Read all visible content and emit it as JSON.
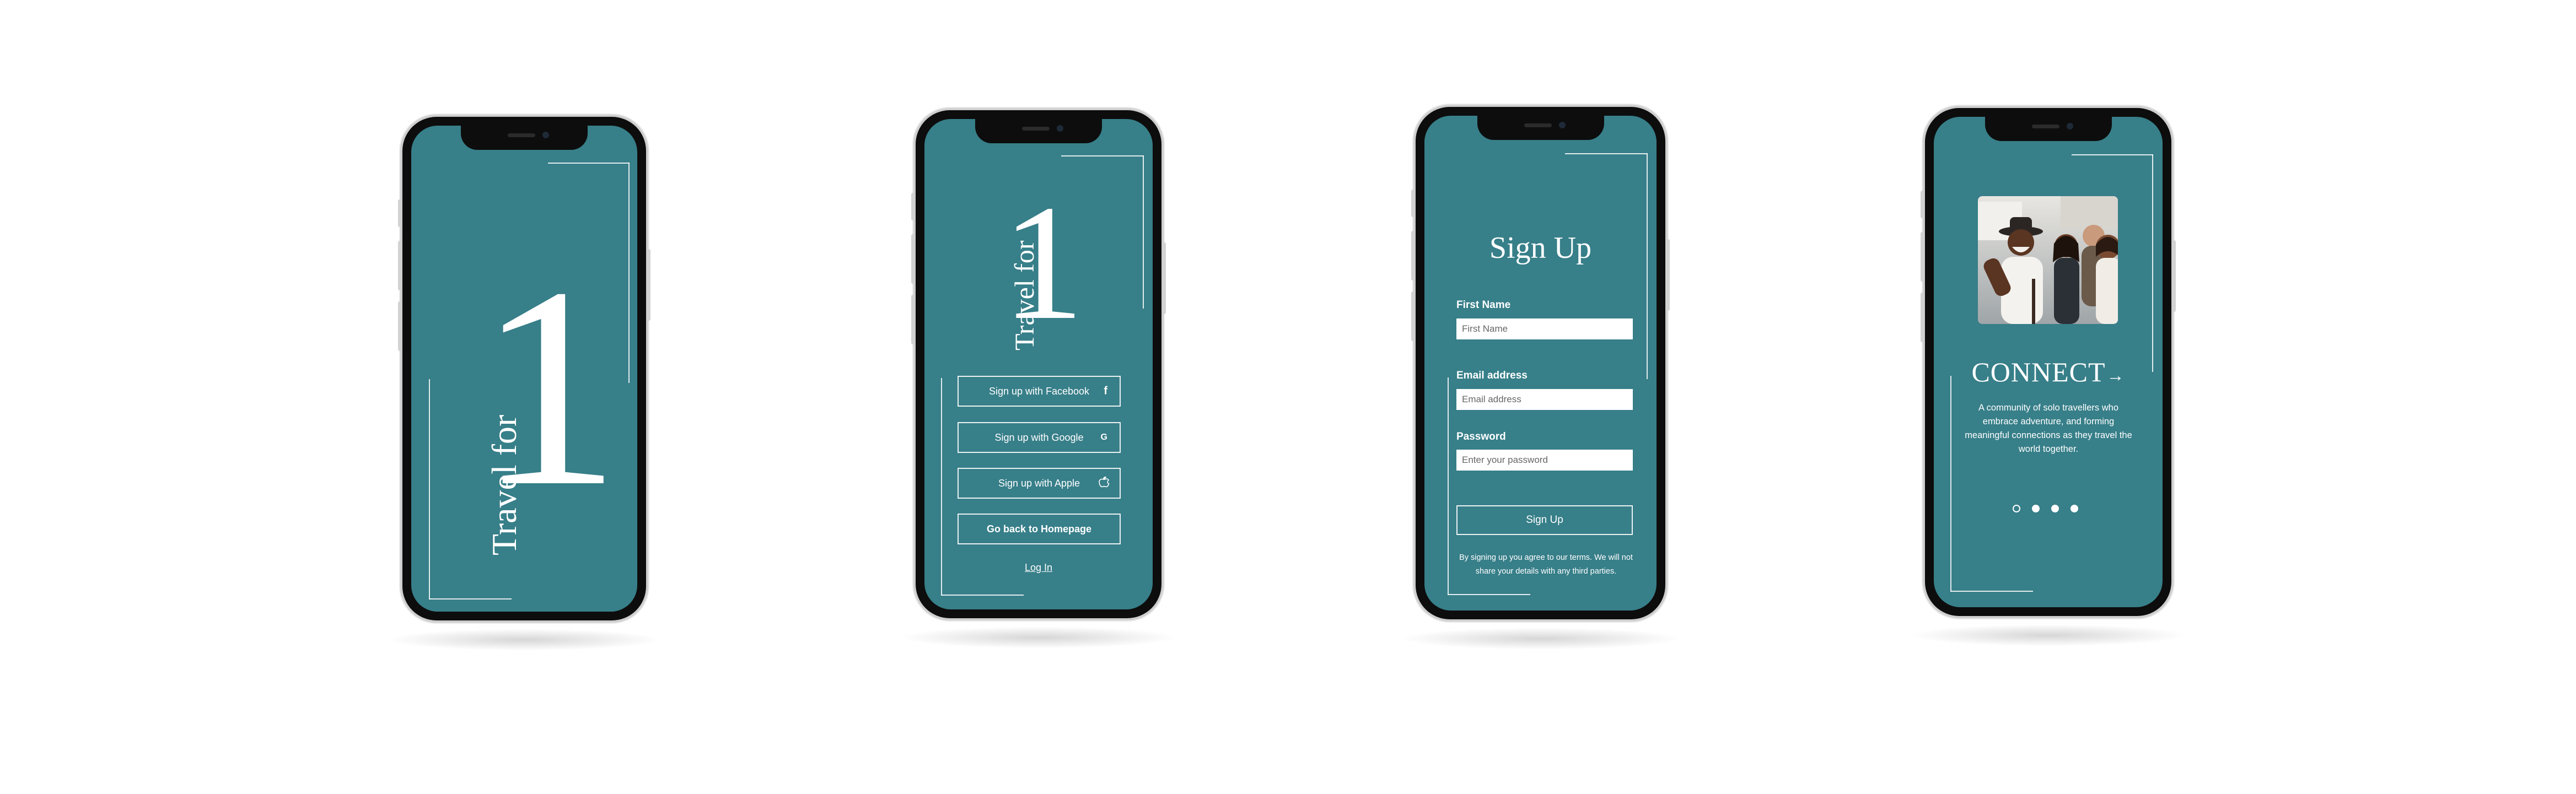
{
  "screen1": {
    "logo_travel": "Travel for",
    "logo_one": "1"
  },
  "screen2": {
    "logo_travel": "Travel for",
    "logo_one": "1",
    "buttons": [
      {
        "label": "Sign up with Facebook",
        "icon": "f"
      },
      {
        "label": "Sign up with Google",
        "icon": "G"
      },
      {
        "label": "Sign up with Apple",
        "icon": ""
      }
    ],
    "homepage_label": "Go back to Homepage",
    "login_label": "Log In"
  },
  "screen3": {
    "title": "Sign Up",
    "first_name_label": "First Name",
    "first_name_placeholder": "First Name",
    "email_label": "Email address",
    "email_placeholder": "Email address",
    "password_label": "Password",
    "password_placeholder": "Enter your password",
    "submit_label": "Sign Up",
    "terms": "By signing up you agree to our terms. We will not share your details with any third parties."
  },
  "screen4": {
    "heading": "CONNECT",
    "arrow": "→",
    "description": "A community of solo travellers who embrace adventure, and forming meaningful connections as they travel the world together.",
    "pagination": {
      "total": 4,
      "active": 0
    }
  },
  "colors": {
    "screen": "#377f89",
    "frame": "#0d0d0d",
    "text": "#ffffff"
  },
  "icons": [
    "facebook-icon",
    "google-icon",
    "apple-icon",
    "arrow-right-icon"
  ]
}
